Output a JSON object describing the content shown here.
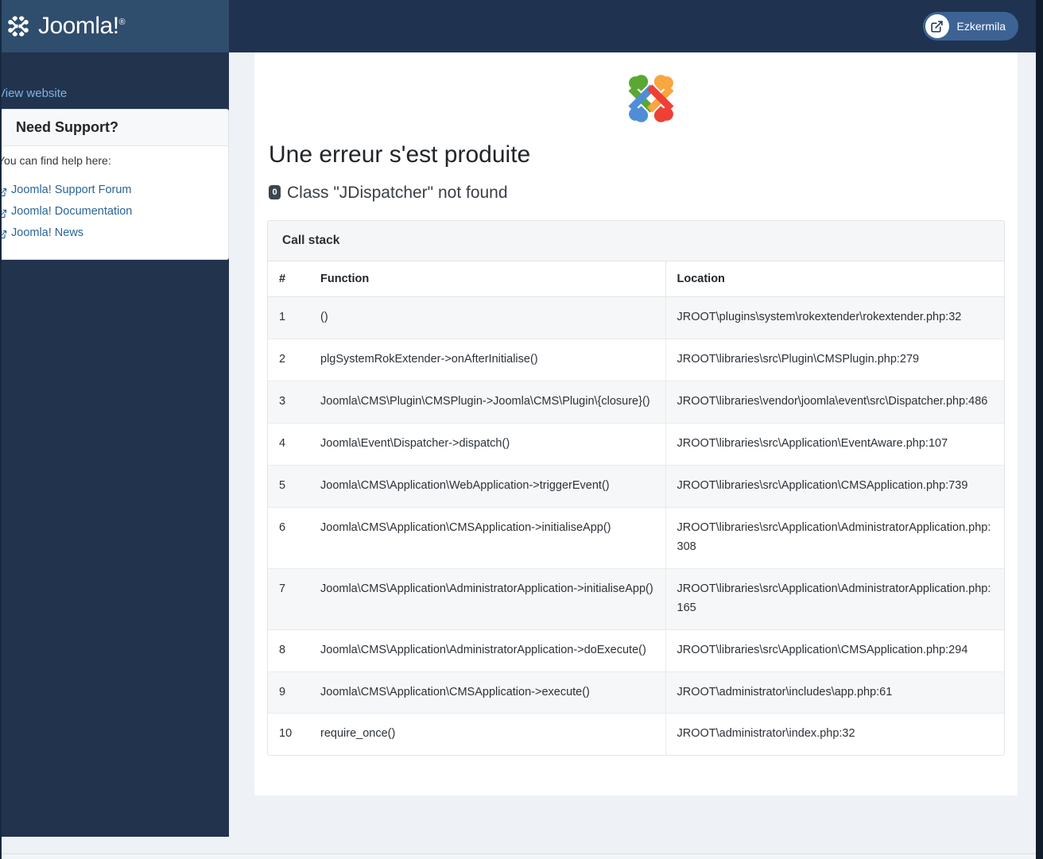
{
  "brand": {
    "name": "Joomla!",
    "registered_mark": "®",
    "logo_icon": "joomla-logo-icon"
  },
  "topbar": {
    "user_badge": {
      "label": "Ezkermila",
      "icon": "external-link-icon"
    },
    "background_color": "#1f3350",
    "brand_block_color": "#2f4d6d"
  },
  "sidebar": {
    "view_website_label": "View website",
    "support_card": {
      "title": "Need Support?",
      "help_text": "You can find help here:",
      "links": [
        {
          "label": "Joomla! Support Forum",
          "icon": "external-link-icon"
        },
        {
          "label": "Joomla! Documentation",
          "icon": "external-link-icon"
        },
        {
          "label": "Joomla! News",
          "icon": "external-link-icon"
        }
      ]
    },
    "background_color": "#21334d",
    "link_color": "#7eb3e8"
  },
  "main": {
    "logo_icon": "joomla-logo-icon",
    "error_title": "Une erreur s'est produite",
    "error_code": "0",
    "error_message": "Class \"JDispatcher\" not found",
    "callstack": {
      "panel_title": "Call stack",
      "columns": [
        "#",
        "Function",
        "Location"
      ],
      "rows": [
        {
          "num": "1",
          "function": "()",
          "location": "JROOT\\plugins\\system\\rokextender\\rokextender.php:32"
        },
        {
          "num": "2",
          "function": "plgSystemRokExtender->onAfterInitialise()",
          "location": "JROOT\\libraries\\src\\Plugin\\CMSPlugin.php:279"
        },
        {
          "num": "3",
          "function": "Joomla\\CMS\\Plugin\\CMSPlugin->Joomla\\CMS\\Plugin\\{closure}()",
          "location": "JROOT\\libraries\\vendor\\joomla\\event\\src\\Dispatcher.php:486"
        },
        {
          "num": "4",
          "function": "Joomla\\Event\\Dispatcher->dispatch()",
          "location": "JROOT\\libraries\\src\\Application\\EventAware.php:107"
        },
        {
          "num": "5",
          "function": "Joomla\\CMS\\Application\\WebApplication->triggerEvent()",
          "location": "JROOT\\libraries\\src\\Application\\CMSApplication.php:739"
        },
        {
          "num": "6",
          "function": "Joomla\\CMS\\Application\\CMSApplication->initialiseApp()",
          "location": "JROOT\\libraries\\src\\Application\\AdministratorApplication.php:308"
        },
        {
          "num": "7",
          "function": "Joomla\\CMS\\Application\\AdministratorApplication->initialiseApp()",
          "location": "JROOT\\libraries\\src\\Application\\AdministratorApplication.php:165"
        },
        {
          "num": "8",
          "function": "Joomla\\CMS\\Application\\AdministratorApplication->doExecute()",
          "location": "JROOT\\libraries\\src\\Application\\CMSApplication.php:294"
        },
        {
          "num": "9",
          "function": "Joomla\\CMS\\Application\\CMSApplication->execute()",
          "location": "JROOT\\administrator\\includes\\app.php:61"
        },
        {
          "num": "10",
          "function": "require_once()",
          "location": "JROOT\\administrator\\index.php:32"
        }
      ]
    }
  },
  "colors": {
    "joomla_green": "#5aa732",
    "joomla_orange": "#f9a541",
    "joomla_blue": "#4f8ed6",
    "joomla_red": "#ee4035",
    "badge_dark": "#3c4650",
    "accent_blue": "#3d6395"
  }
}
